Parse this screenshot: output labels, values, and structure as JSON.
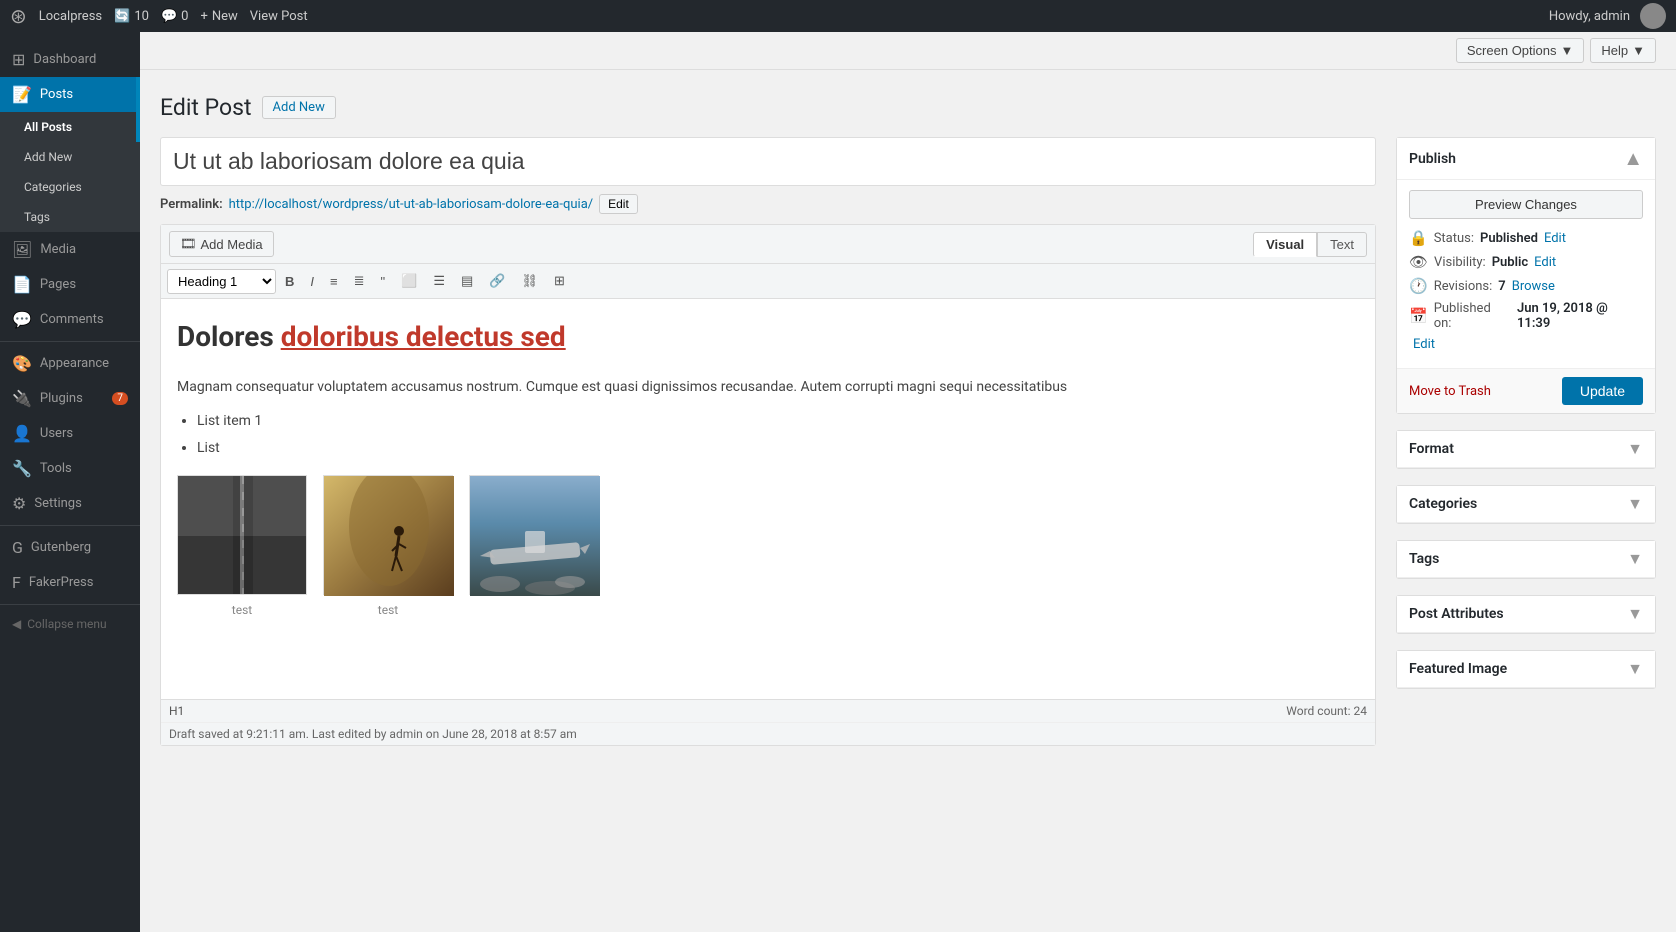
{
  "adminbar": {
    "site_name": "Localpress",
    "update_count": "10",
    "comment_count": "0",
    "new_label": "New",
    "view_post_label": "View Post",
    "howdy": "Howdy, admin"
  },
  "top_bar": {
    "screen_options_label": "Screen Options",
    "help_label": "Help"
  },
  "page_header": {
    "title": "Edit Post",
    "add_new_label": "Add New"
  },
  "post": {
    "title": "Ut ut ab laboriosam dolore ea quia",
    "permalink_label": "Permalink:",
    "permalink_url": "http://localhost/wordpress/ut-ut-ab-laboriosam-dolore-ea-quia/",
    "permalink_edit_label": "Edit"
  },
  "editor_toolbar": {
    "add_media_label": "Add Media",
    "visual_tab": "Visual",
    "text_tab": "Text",
    "heading_select": "Heading 1"
  },
  "editor": {
    "heading": "Dolores",
    "heading_underline": "doloribus delectus sed",
    "paragraph": "Magnam consequatur voluptatem accusamus nostrum. Cumque est quasi dignissimos recusandae. Autem corrupti magni sequi necessitatibus",
    "list_item_1": "List item 1",
    "list_item_2": "List",
    "image1_caption": "test",
    "image2_caption": "test",
    "path": "H1",
    "word_count_label": "Word count:",
    "word_count": "24",
    "draft_status": "Draft saved at 9:21:11 am. Last edited by admin on June 28, 2018 at 8:57 am"
  },
  "publish_box": {
    "title": "Publish",
    "preview_btn": "Preview Changes",
    "status_label": "Status:",
    "status_value": "Published",
    "status_edit": "Edit",
    "visibility_label": "Visibility:",
    "visibility_value": "Public",
    "visibility_edit": "Edit",
    "revisions_label": "Revisions:",
    "revisions_value": "7",
    "revisions_link": "Browse",
    "published_label": "Published on:",
    "published_value": "Jun 19, 2018 @ 11:39",
    "published_edit": "Edit",
    "move_to_trash": "Move to Trash",
    "update_btn": "Update"
  },
  "format_box": {
    "title": "Format"
  },
  "categories_box": {
    "title": "Categories"
  },
  "tags_box": {
    "title": "Tags"
  },
  "post_attributes_box": {
    "title": "Post Attributes"
  },
  "featured_image_box": {
    "title": "Featured Image"
  },
  "sidebar": {
    "items": [
      {
        "label": "Dashboard",
        "icon": "⊞"
      },
      {
        "label": "Posts",
        "icon": "📝"
      },
      {
        "label": "Media",
        "icon": "🖼"
      },
      {
        "label": "Pages",
        "icon": "📄"
      },
      {
        "label": "Comments",
        "icon": "💬"
      },
      {
        "label": "Appearance",
        "icon": "🎨"
      },
      {
        "label": "Plugins",
        "icon": "🔌",
        "badge": "7"
      },
      {
        "label": "Users",
        "icon": "👤"
      },
      {
        "label": "Tools",
        "icon": "🔧"
      },
      {
        "label": "Settings",
        "icon": "⚙"
      },
      {
        "label": "Gutenberg",
        "icon": "G"
      },
      {
        "label": "FakerPress",
        "icon": "F"
      }
    ],
    "submenu_posts": [
      {
        "label": "All Posts"
      },
      {
        "label": "Add New"
      },
      {
        "label": "Categories"
      },
      {
        "label": "Tags"
      }
    ],
    "collapse_label": "Collapse menu"
  }
}
